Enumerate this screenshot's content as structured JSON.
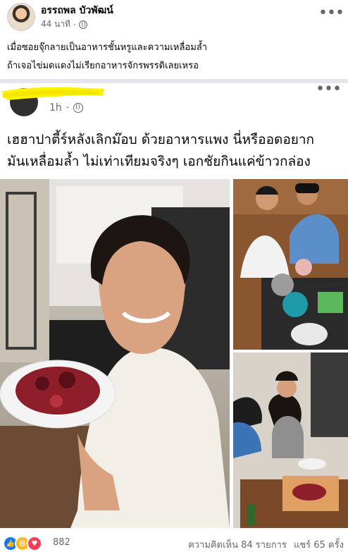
{
  "outer_post": {
    "author": "อรรถพล บัวพัฒน์",
    "time": "44 นาที",
    "more_icon": "more-horizontal-icon",
    "text_line1": "เมื่อซอยจุ๊กลายเป็นอาหารชั้นหรูและความเหลื่อมล้ำ",
    "text_line2": "ถ้าเจอไข่มดแดงไม่เรียกอาหารจักรพรรดิเลยเหรอ"
  },
  "shared_post": {
    "time": "1h",
    "text_line1": "เฮฮาปาตี้ร์หลังเลิกม๊อบ ด้วยอาหารแพง นี่หรืออดอยาก",
    "text_line2": "มันเหลื่อมล้ำ ไม่เท่าเทียมจริงๆ เอกชัยกินแค่ข้าวกล่อง"
  },
  "footer": {
    "reaction_count": "882",
    "comments": "ความคิดเห็น 84 รายการ",
    "shares": "แชร์ 65 ครั้ง"
  },
  "colors": {
    "like": "#1877f2",
    "haha": "#f7b928",
    "love": "#f33e58"
  }
}
